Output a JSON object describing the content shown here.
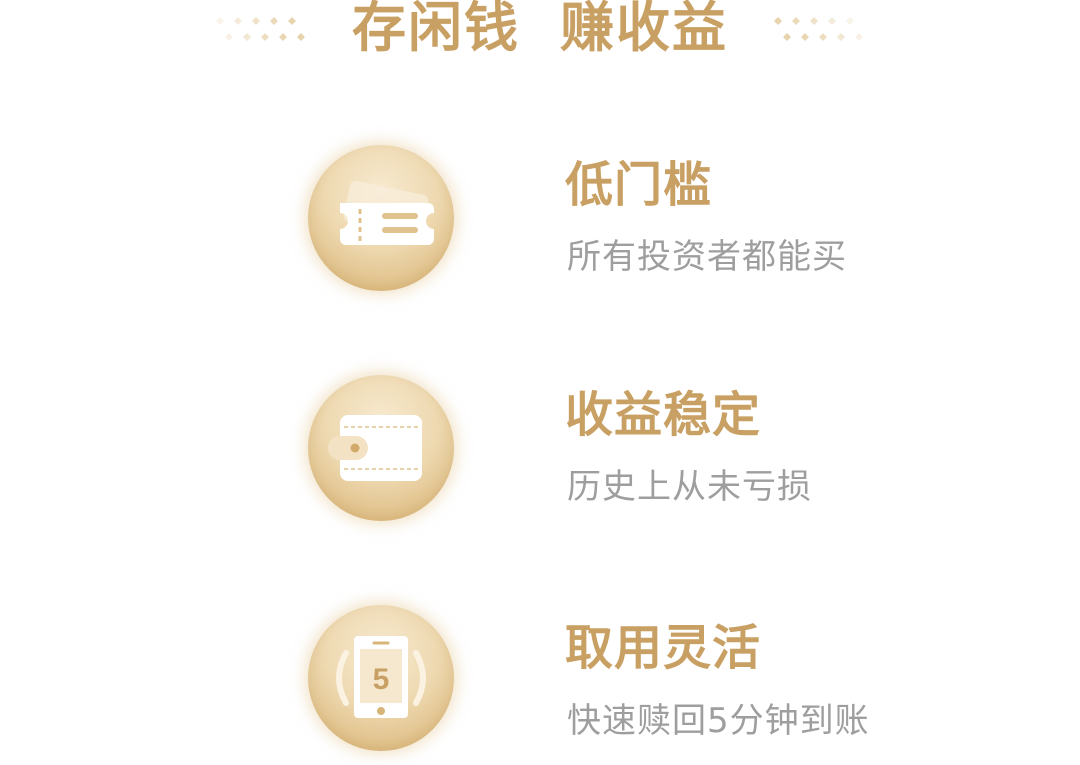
{
  "header": {
    "title_part1": "存闲钱",
    "title_part2": "赚收益"
  },
  "colors": {
    "gold": "#C9A063",
    "gray_text": "#9E9E9E",
    "background": "#FFFFFF"
  },
  "features": [
    {
      "icon": "ticket-icon",
      "title": "低门槛",
      "description": "所有投资者都能买"
    },
    {
      "icon": "wallet-icon",
      "title": "收益稳定",
      "description": "历史上从未亏损"
    },
    {
      "icon": "phone-icon",
      "title": "取用灵活",
      "description": "快速赎回5分钟到账",
      "icon_text": "5"
    }
  ]
}
